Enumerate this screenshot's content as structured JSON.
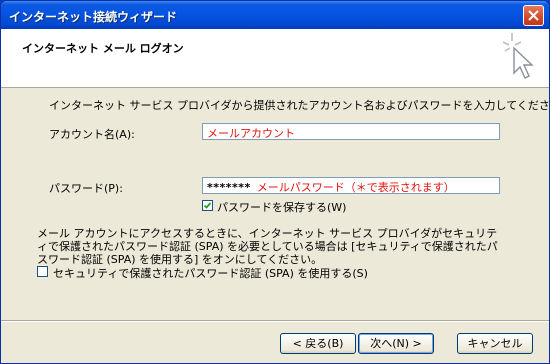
{
  "window": {
    "title": "インターネット接続ウィザード",
    "close_icon": "close-icon"
  },
  "header": {
    "title": "インターネット メール ログオン",
    "art_icon": "wizard-cursor-icon"
  },
  "form": {
    "intro": "インターネット サービス プロバイダから提供されたアカウント名およびパスワードを入力してください。",
    "account_label": "アカウント名(A):",
    "account_value": "メールアカウント",
    "password_label": "パスワード(P):",
    "password_mask": "*******",
    "password_hint": "メールパスワード（＊で表示されます）",
    "remember_password": {
      "label": "パスワードを保存する(W)",
      "checked": true
    },
    "spa_notice": "メール アカウントにアクセスするときに、インターネット サービス プロバイダがセキュリティで保護されたパスワード認証 (SPA) を必要としている場合は [セキュリティで保護されたパスワード認証 (SPA) を使用する] をオンにしてください。",
    "spa_option": {
      "label": "セキュリティで保護されたパスワード認証 (SPA) を使用する(S)",
      "checked": false
    }
  },
  "buttons": {
    "back": "< 戻る(B)",
    "next": "次へ(N) >",
    "cancel": "キャンセル"
  },
  "colors": {
    "accent_red": "#e0140f",
    "titlebar_blue": "#0554e3"
  }
}
